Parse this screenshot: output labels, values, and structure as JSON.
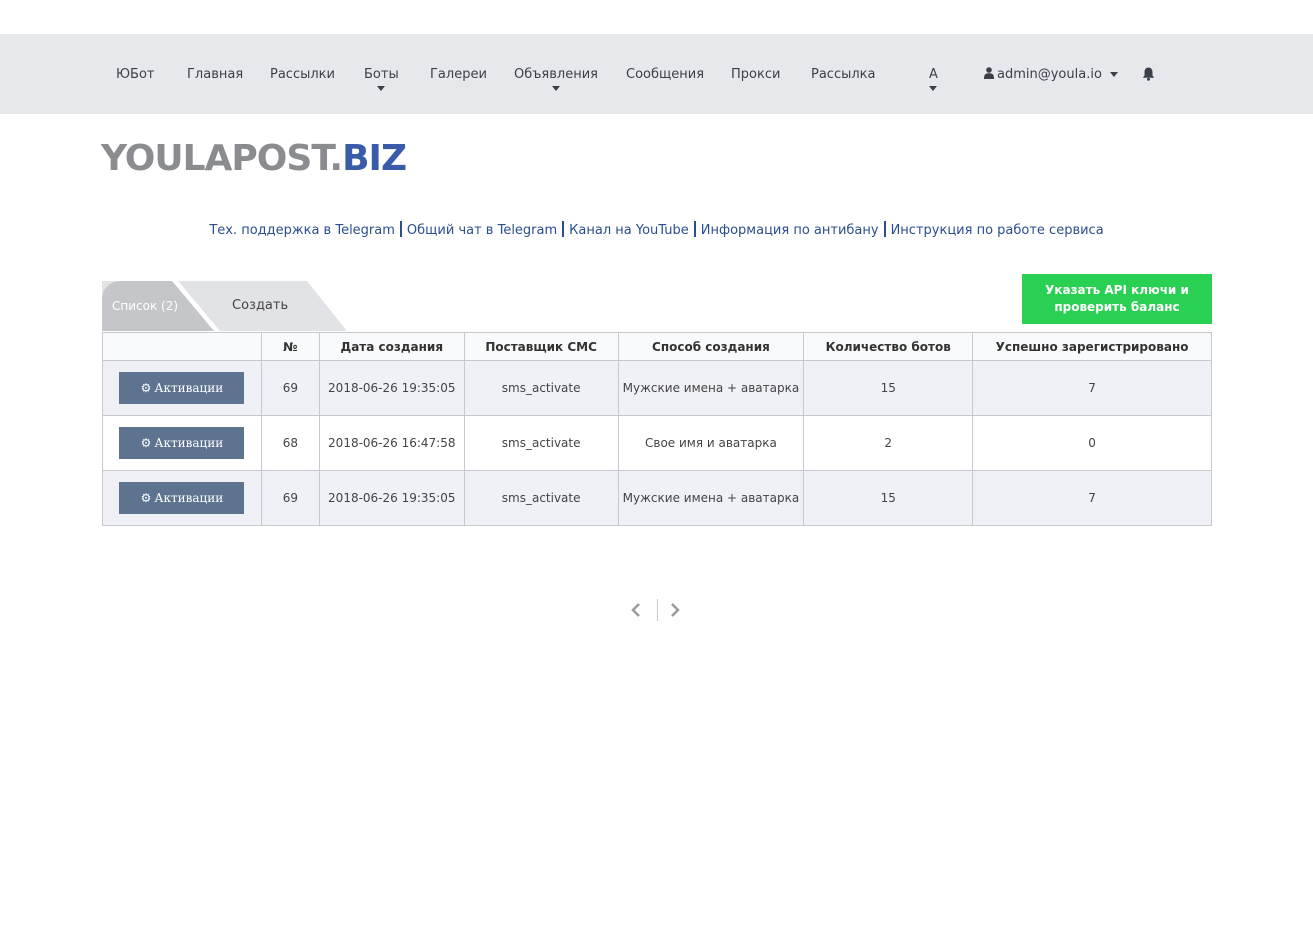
{
  "nav": {
    "items": [
      {
        "label": "ЮБот"
      },
      {
        "label": "Главная"
      },
      {
        "label": "Рассылки"
      },
      {
        "label": "Боты"
      },
      {
        "label": "Галереи"
      },
      {
        "label": "Объявления"
      },
      {
        "label": "Сообщения"
      },
      {
        "label": "Прокси"
      },
      {
        "label": "Рассылка"
      },
      {
        "label": "A"
      }
    ],
    "user": "admin@youla.io",
    "icons": {
      "user": "user-icon",
      "bell": "bell-icon"
    }
  },
  "logo": {
    "part1": "YOULAPOST.",
    "part2": "BIZ",
    "color1": "#8a8c90",
    "color2": "#3a5ba8"
  },
  "links": [
    "Тех. поддержка в Telegram",
    "Общий чат в Telegram",
    "Канал на YouTube",
    "Информация по антибану",
    "Инструкция по работе сервиса"
  ],
  "tabs": {
    "list": "Список (2)",
    "create": "Создать"
  },
  "api_button": {
    "line1": "Указать API ключи и",
    "line2": "проверить баланс",
    "color": "#2ad051"
  },
  "table": {
    "headers": [
      "",
      "№",
      "Дата создания",
      "Поставщик СМС",
      "Способ создания",
      "Количество ботов",
      "Успешно зарегистрировано"
    ],
    "action_label": "Активации",
    "rows": [
      {
        "num": "69",
        "date": "2018-06-26 19:35:05",
        "provider": "sms_activate",
        "method": "Мужские имена + аватарка",
        "bots": "15",
        "registered": "7"
      },
      {
        "num": "68",
        "date": "2018-06-26 16:47:58",
        "provider": "sms_activate",
        "method": "Свое имя и аватарка",
        "bots": "2",
        "registered": "0"
      },
      {
        "num": "69",
        "date": "2018-06-26 19:35:05",
        "provider": "sms_activate",
        "method": "Мужские имена + аватарка",
        "bots": "15",
        "registered": "7"
      }
    ]
  },
  "pagination": {
    "prev_icon": "chevron-left-icon",
    "next_icon": "chevron-right-icon"
  }
}
